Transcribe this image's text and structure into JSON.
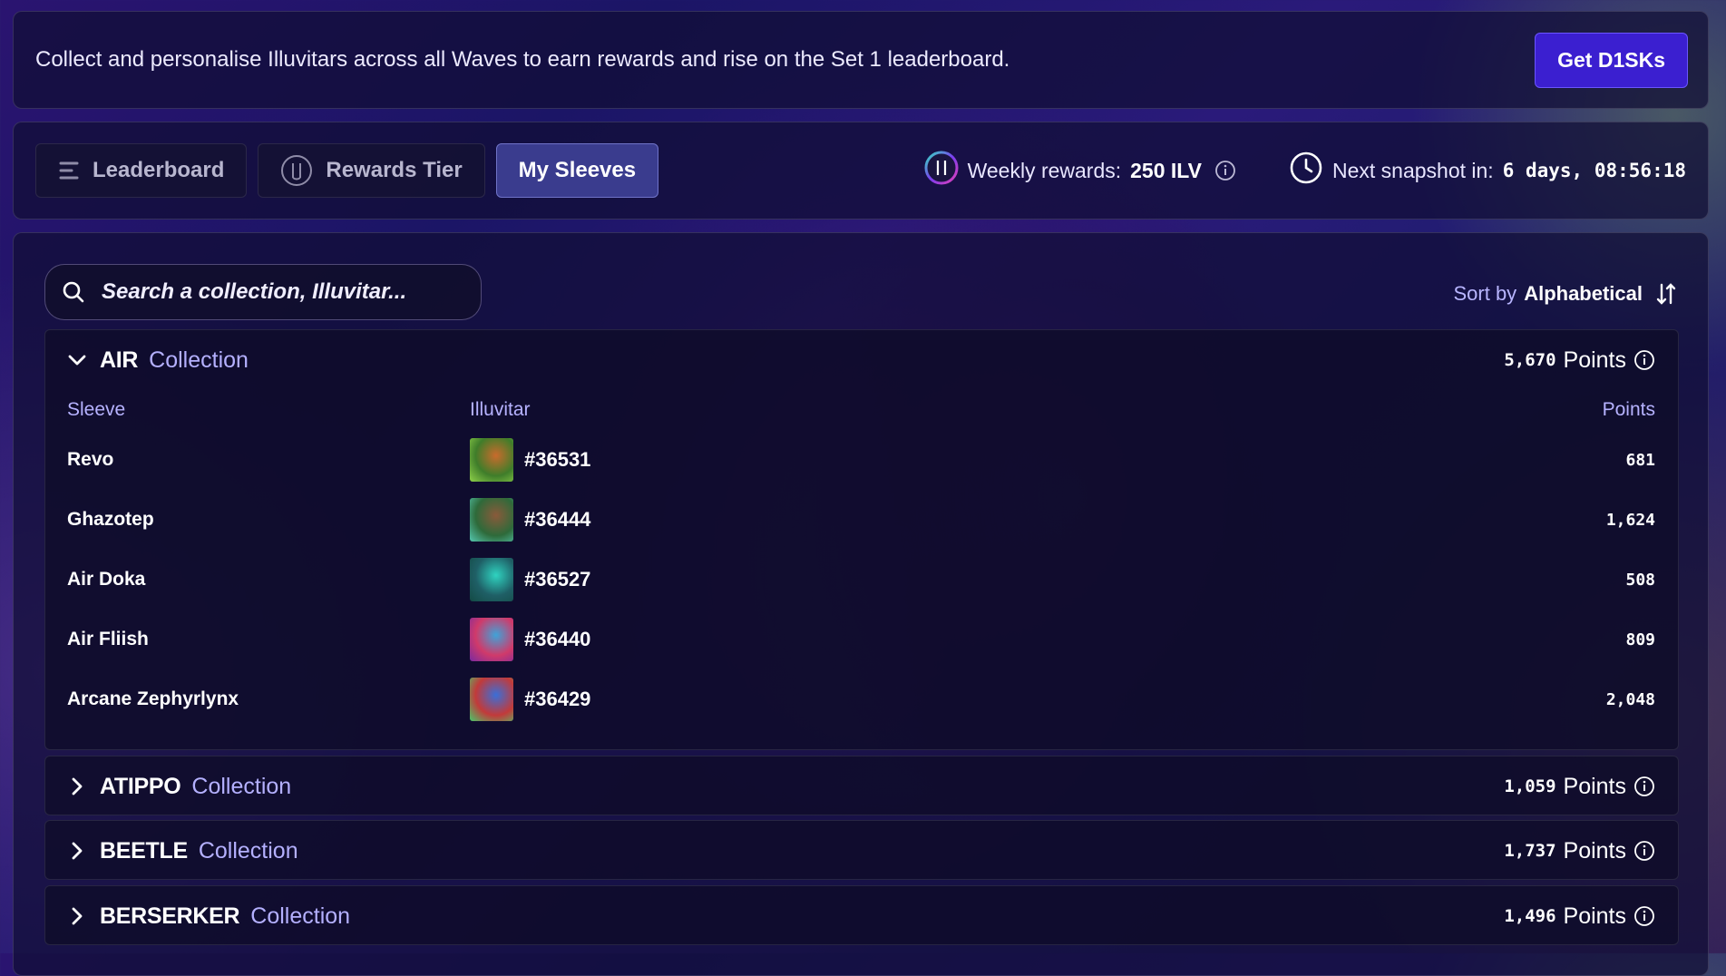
{
  "banner": {
    "message": "Collect and personalise Illuvitars across all Waves to earn rewards and rise on the Set 1 leaderboard.",
    "cta_label": "Get D1SKs"
  },
  "tabs": [
    {
      "label": "Leaderboard",
      "icon": "list-icon",
      "active": false
    },
    {
      "label": "Rewards Tier",
      "icon": "ilv-badge-icon",
      "active": false
    },
    {
      "label": "My Sleeves",
      "active": true
    }
  ],
  "stats": {
    "weekly_label": "Weekly rewards:",
    "weekly_value": "250 ILV",
    "snapshot_label": "Next snapshot in:",
    "snapshot_value": "6 days, 08:56:18"
  },
  "search": {
    "placeholder": "Search a collection, Illuvitar..."
  },
  "sort": {
    "label": "Sort by",
    "value": "Alphabetical"
  },
  "table_headers": {
    "sleeve": "Sleeve",
    "illuvitar": "Illuvitar",
    "points": "Points"
  },
  "collections": [
    {
      "name": "AIR",
      "suffix": "Collection",
      "points": "5,670",
      "points_label": "Points",
      "expanded": true,
      "rows": [
        {
          "sleeve": "Revo",
          "illuvitar": "#36531",
          "points": "681",
          "thumb_colors": [
            "#3f7d2a",
            "#c96b2c",
            "#8fd14a"
          ]
        },
        {
          "sleeve": "Ghazotep",
          "illuvitar": "#36444",
          "points": "1,624",
          "thumb_colors": [
            "#2e6a3a",
            "#8a5a3a",
            "#55c8b0"
          ]
        },
        {
          "sleeve": "Air Doka",
          "illuvitar": "#36527",
          "points": "508",
          "thumb_colors": [
            "#1f5f66",
            "#2fd3c0",
            "#134a44"
          ]
        },
        {
          "sleeve": "Air Fliish",
          "illuvitar": "#36440",
          "points": "809",
          "thumb_colors": [
            "#d03a6a",
            "#3fa3d8",
            "#7a2aa0"
          ]
        },
        {
          "sleeve": "Arcane Zephyrlynx",
          "illuvitar": "#36429",
          "points": "2,048",
          "thumb_colors": [
            "#c23a3a",
            "#3a6fd8",
            "#48c86a"
          ]
        }
      ]
    },
    {
      "name": "ATIPPO",
      "suffix": "Collection",
      "points": "1,059",
      "points_label": "Points",
      "expanded": false
    },
    {
      "name": "BEETLE",
      "suffix": "Collection",
      "points": "1,737",
      "points_label": "Points",
      "expanded": false
    },
    {
      "name": "BERSERKER",
      "suffix": "Collection",
      "points": "1,496",
      "points_label": "Points",
      "expanded": false
    }
  ]
}
